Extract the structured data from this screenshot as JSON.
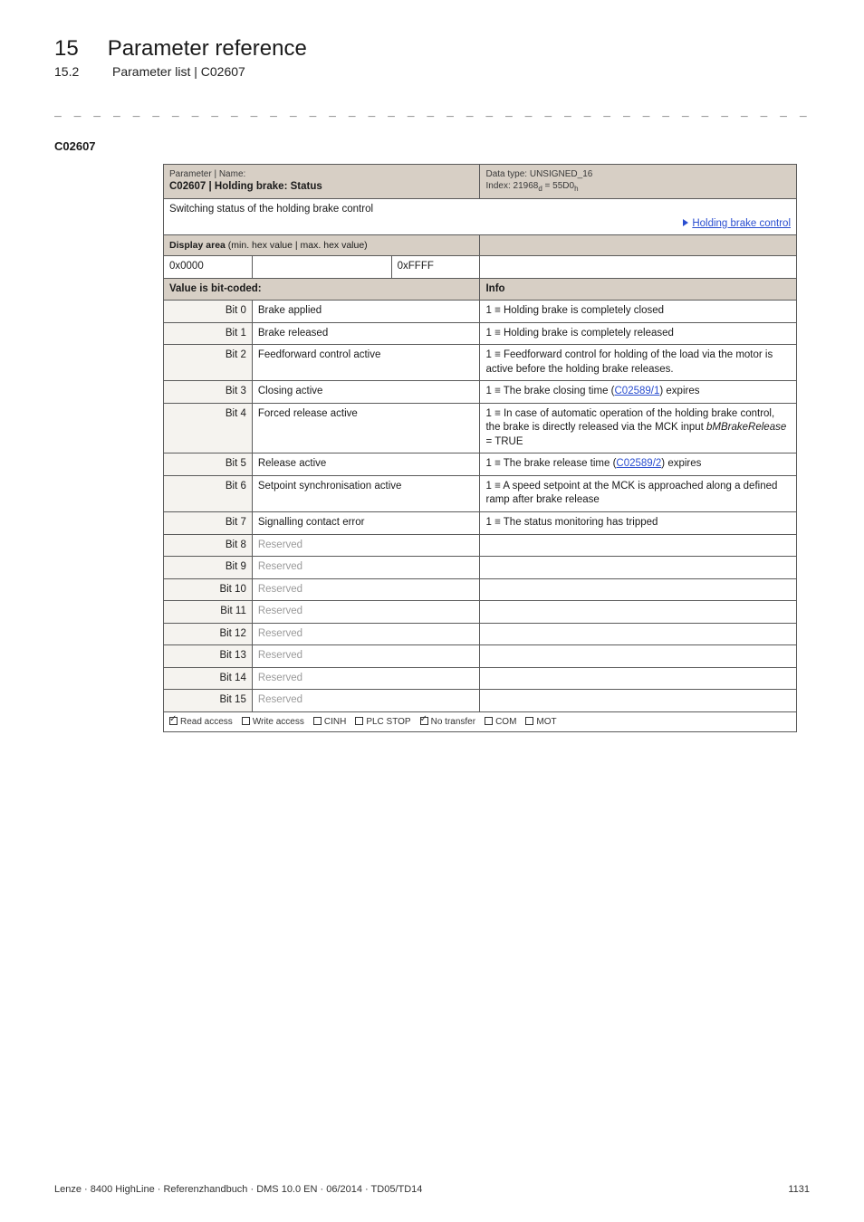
{
  "header": {
    "chapter_num": "15",
    "chapter_title": "Parameter reference",
    "sub_num": "15.2",
    "sub_title": "Parameter list | C02607"
  },
  "anchor": "C02607",
  "param_head": {
    "label": "Parameter | Name:",
    "value": "C02607 | Holding brake: Status",
    "dtype": "Data type: UNSIGNED_16",
    "index_prefix": "Index: 21968",
    "index_sub1": "d",
    "index_eq": " = 55D0",
    "index_sub2": "h"
  },
  "switching_text": "Switching status of the holding brake control",
  "link_text": "Holding brake control",
  "display_area_label": "Display area",
  "display_area_suffix": " (min. hex value | max. hex value)",
  "range": {
    "min": "0x0000",
    "mid": "",
    "max": "0xFFFF"
  },
  "vbc_label": "Value is bit-coded:",
  "info_label": "Info",
  "bits": [
    {
      "label": "Bit 0",
      "name": "Brake applied",
      "desc": "1 ≡ Holding brake is completely closed"
    },
    {
      "label": "Bit 1",
      "name": "Brake released",
      "desc": "1 ≡ Holding brake is completely released"
    },
    {
      "label": "Bit 2",
      "name": "Feedforward control active",
      "desc": "1 ≡ Feedforward control for holding of the load via the motor is active before the holding brake releases."
    },
    {
      "label": "Bit 3",
      "name": "Closing active",
      "desc_pre": "1 ≡ The brake closing time (",
      "desc_link": "C02589/1",
      "desc_post": ") expires"
    },
    {
      "label": "Bit 4",
      "name": "Forced release active",
      "desc_pre": "1 ≡ In case of automatic operation of the holding brake control, the brake is directly released via the MCK input ",
      "desc_italic": "bMBrakeRelease",
      "desc_post": " = TRUE"
    },
    {
      "label": "Bit 5",
      "name": "Release active",
      "desc_pre": "1 ≡ The brake release time (",
      "desc_link": "C02589/2",
      "desc_post": ") expires"
    },
    {
      "label": "Bit 6",
      "name": "Setpoint synchronisation active",
      "desc": "1 ≡ A speed setpoint at the MCK is approached along a defined ramp after brake release"
    },
    {
      "label": "Bit 7",
      "name": "Signalling contact error",
      "desc": "1 ≡ The status monitoring has tripped"
    },
    {
      "label": "Bit 8",
      "name": "Reserved",
      "reserved": true
    },
    {
      "label": "Bit 9",
      "name": "Reserved",
      "reserved": true
    },
    {
      "label": "Bit 10",
      "name": "Reserved",
      "reserved": true
    },
    {
      "label": "Bit 11",
      "name": "Reserved",
      "reserved": true
    },
    {
      "label": "Bit 12",
      "name": "Reserved",
      "reserved": true
    },
    {
      "label": "Bit 13",
      "name": "Reserved",
      "reserved": true
    },
    {
      "label": "Bit 14",
      "name": "Reserved",
      "reserved": true
    },
    {
      "label": "Bit 15",
      "name": "Reserved",
      "reserved": true
    }
  ],
  "access": [
    {
      "checked": true,
      "label": "Read access"
    },
    {
      "checked": false,
      "label": "Write access"
    },
    {
      "checked": false,
      "label": "CINH"
    },
    {
      "checked": false,
      "label": "PLC STOP"
    },
    {
      "checked": true,
      "label": "No transfer"
    },
    {
      "checked": false,
      "label": "COM"
    },
    {
      "checked": false,
      "label": "MOT"
    }
  ],
  "footer": {
    "left": "Lenze · 8400 HighLine · Referenzhandbuch · DMS 10.0 EN · 06/2014 · TD05/TD14",
    "right": "1131"
  }
}
